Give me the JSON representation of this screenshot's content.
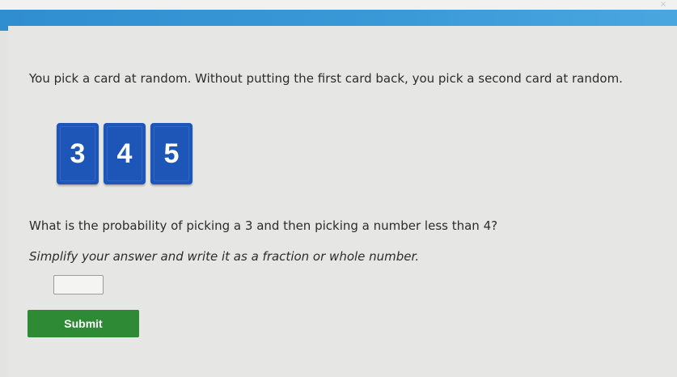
{
  "header": {
    "close_glyph": "×"
  },
  "question": {
    "text": "You pick a card at random. Without putting the first card back, you pick a second card at random.",
    "cards": [
      {
        "value": "3"
      },
      {
        "value": "4"
      },
      {
        "value": "5"
      }
    ],
    "prompt": "What is the probability of picking a 3 and then picking a number less than 4?",
    "instruction": "Simplify your answer and write it as a fraction or whole number."
  },
  "answer": {
    "value": ""
  },
  "submit": {
    "label": "Submit"
  },
  "colors": {
    "header_bar": "#2f8ed0",
    "card": "#1e56b8",
    "submit": "#2f8a36"
  }
}
